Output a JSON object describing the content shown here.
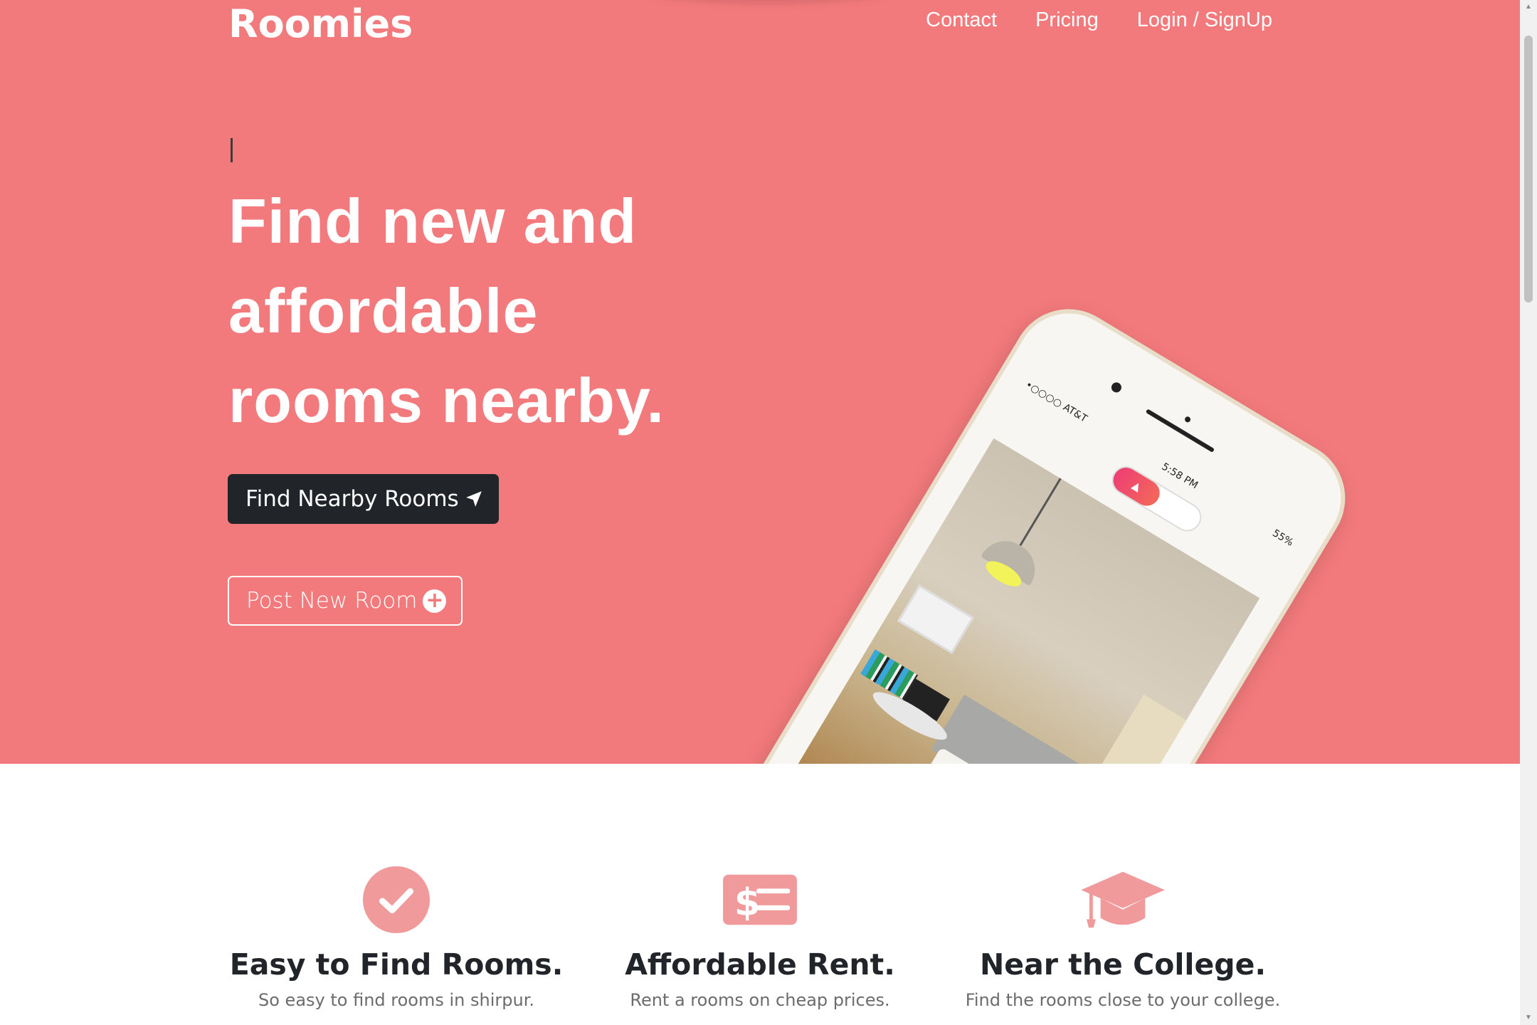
{
  "brand": "Roomies",
  "nav": [
    {
      "label": "Contact"
    },
    {
      "label": "Pricing"
    },
    {
      "label": "Login / SignUp"
    }
  ],
  "hero": {
    "headline_lines": [
      "Find new and",
      "affordable",
      "rooms nearby."
    ],
    "primary_button": "Find Nearby Rooms",
    "primary_button_icon": "paper-plane-icon",
    "secondary_button": "Post New Room",
    "secondary_button_icon": "plus-circle-icon"
  },
  "phone": {
    "carrier": "•○○○○ AT&T",
    "time": "5:58 PM",
    "battery": "55%"
  },
  "features": [
    {
      "icon": "check-circle-icon",
      "title": "Easy to Find Rooms.",
      "desc": "So easy to find rooms in shirpur."
    },
    {
      "icon": "money-bill-icon",
      "title": "Affordable Rent.",
      "desc": "Rent a rooms on cheap prices."
    },
    {
      "icon": "graduation-cap-icon",
      "title": "Near the College.",
      "desc": "Find the rooms close to your college."
    }
  ],
  "colors": {
    "hero_bg": "#f37a7c",
    "dark_button": "#212529",
    "feature_icon": "#f19a9b",
    "title_text": "#212529"
  }
}
